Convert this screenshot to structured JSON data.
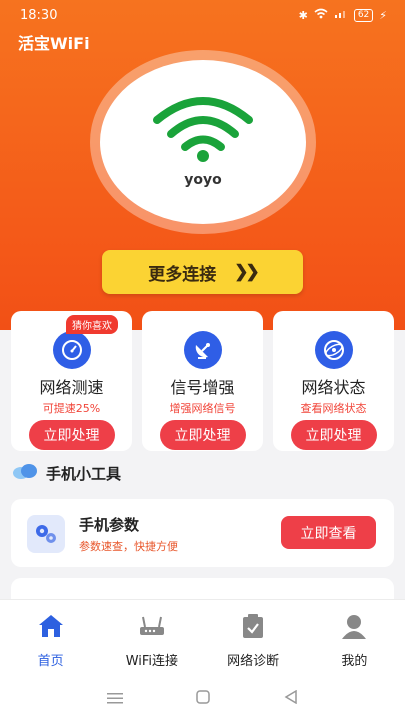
{
  "status_bar": {
    "time": "18:30",
    "battery": "62"
  },
  "app": {
    "title": "活宝WiFi"
  },
  "connection": {
    "ssid": "yoyo",
    "more_button": "更多连接"
  },
  "feature_cards": [
    {
      "title": "网络测速",
      "subtitle": "可提速25%",
      "button": "立即处理",
      "tag": "猜你喜欢",
      "icon": "speedometer-icon"
    },
    {
      "title": "信号增强",
      "subtitle": "增强网络信号",
      "button": "立即处理",
      "icon": "satellite-dish-icon"
    },
    {
      "title": "网络状态",
      "subtitle": "查看网络状态",
      "button": "立即处理",
      "icon": "globe-icon"
    }
  ],
  "tools": {
    "heading": "手机小工具",
    "items": [
      {
        "title": "手机参数",
        "subtitle": "参数速查，快捷方便",
        "button": "立即查看",
        "icon": "gears-icon"
      }
    ]
  },
  "tab_bar": {
    "items": [
      {
        "label": "首页",
        "icon": "home-icon",
        "active": true
      },
      {
        "label": "WiFi连接",
        "icon": "router-icon",
        "active": false
      },
      {
        "label": "网络诊断",
        "icon": "clipboard-check-icon",
        "active": false
      },
      {
        "label": "我的",
        "icon": "user-icon",
        "active": false
      }
    ]
  },
  "colors": {
    "hero_orange": "#f45a19",
    "accent_yellow": "#fbd333",
    "action_red": "#ee3f48",
    "wifi_green": "#1aa33a",
    "active_blue": "#2d60e0"
  }
}
